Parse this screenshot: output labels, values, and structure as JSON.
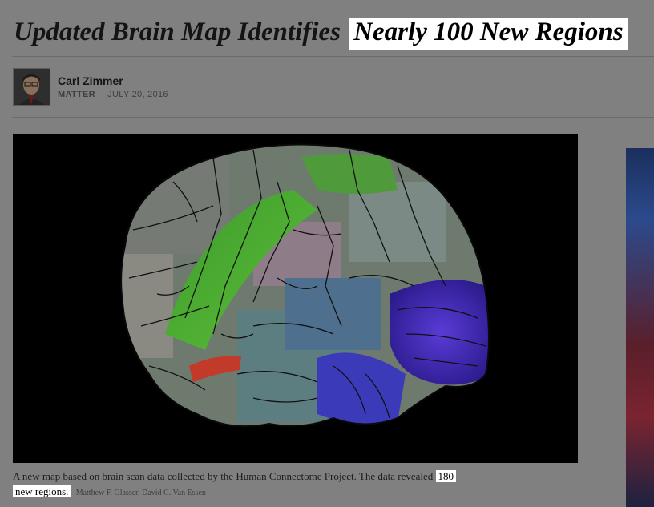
{
  "article": {
    "headline_prefix": "Updated Brain Map Identifies",
    "headline_highlight": "Nearly 100 New Regions",
    "author": "Carl Zimmer",
    "section": "MATTER",
    "date": "JULY 20, 2016"
  },
  "image": {
    "caption_text": "A new map based on brain scan data collected by the Human Connectome Project. The data revealed",
    "caption_highlight_1": "180",
    "caption_highlight_2": "new regions.",
    "credit": "Matthew F. Glasser, David C. Van Essen"
  },
  "colors": {
    "page_background": "#808080",
    "highlight": "#ffffff",
    "image_background": "#000000"
  }
}
